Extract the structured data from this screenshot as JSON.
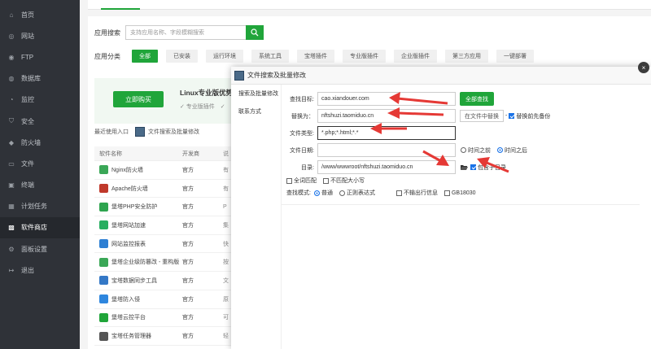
{
  "sidebar": {
    "items": [
      {
        "label": "首页",
        "icon": "home-icon"
      },
      {
        "label": "网站",
        "icon": "globe-icon"
      },
      {
        "label": "FTP",
        "icon": "ftp-icon"
      },
      {
        "label": "数据库",
        "icon": "database-icon"
      },
      {
        "label": "监控",
        "icon": "monitor-icon"
      },
      {
        "label": "安全",
        "icon": "shield-icon"
      },
      {
        "label": "防火墙",
        "icon": "firewall-icon"
      },
      {
        "label": "文件",
        "icon": "folder-icon"
      },
      {
        "label": "终端",
        "icon": "terminal-icon"
      },
      {
        "label": "计划任务",
        "icon": "calendar-icon"
      },
      {
        "label": "软件商店",
        "icon": "grid-icon",
        "active": true
      },
      {
        "label": "面板设置",
        "icon": "gear-icon"
      },
      {
        "label": "退出",
        "icon": "logout-icon"
      }
    ]
  },
  "store": {
    "search_label": "应用搜索",
    "search_placeholder": "支持应用名称、字段模糊搜索",
    "category_label": "应用分类",
    "categories": [
      "全部",
      "已安装",
      "运行环境",
      "系统工具",
      "宝塔插件",
      "专业版插件",
      "企业版插件",
      "第三方应用",
      "一键部署"
    ],
    "promo_button": "立即购买",
    "promo_title": "Linux专业版优势",
    "promo_feature": "✓ 专业版插件　✓",
    "recent_label": "最近使用入口",
    "recent_app": "文件搜索及批量修改",
    "columns": [
      "软件名称",
      "开发商",
      "说"
    ],
    "rows": [
      {
        "name": "Nginx防火墙",
        "dev": "官方",
        "extra": "有",
        "color": "#3aa757"
      },
      {
        "name": "Apache防火墙",
        "dev": "官方",
        "extra": "有",
        "color": "#c0392b"
      },
      {
        "name": "堡塔PHP安全防护",
        "dev": "官方",
        "extra": "P",
        "color": "#2ea44f"
      },
      {
        "name": "堡塔网站加速",
        "dev": "官方",
        "extra": "集",
        "color": "#27ae60"
      },
      {
        "name": "网站监控报表",
        "dev": "官方",
        "extra": "快",
        "color": "#2d7fd3"
      },
      {
        "name": "堡塔企业级防篡改 - 重构版",
        "dev": "官方",
        "extra": "按",
        "color": "#3aa757"
      },
      {
        "name": "宝塔数据同步工具",
        "dev": "官方",
        "extra": "文",
        "color": "#3478c6"
      },
      {
        "name": "堡塔防入侵",
        "dev": "官方",
        "extra": "原",
        "color": "#2e86de"
      },
      {
        "name": "堡塔云控平台",
        "dev": "官方",
        "extra": "可",
        "color": "#20a53a"
      },
      {
        "name": "宝塔任务管理器",
        "dev": "官方",
        "extra": "轻",
        "color": "#555"
      }
    ]
  },
  "dialog": {
    "title": "文件搜索及批量修改",
    "close": "×",
    "side_items": [
      "搜索及批量修改",
      "联系方式"
    ],
    "search_target_label": "查找目标:",
    "search_target_value": "cao.xiandouer.com",
    "search_all_button": "全部查找",
    "replace_label": "替换为：",
    "replace_value": "nftshuzi.taomiduo.cn",
    "replace_in_files_button": "在文件中替换",
    "backup_label": "替换前先备份",
    "file_type_label": "文件类型:",
    "file_type_value": "*.php;*.html;*.*",
    "file_date_label": "文件日期:",
    "date_before_label": "时间之前",
    "date_after_label": "时间之后",
    "directory_label": "目录:",
    "directory_value": "/www/wwwroot/nftshuzi.taomiduo.cn",
    "include_subdir_label": "包含子目录",
    "whole_word_label": "全词匹配",
    "case_insensitive_label": "不匹配大小写",
    "search_mode_label": "查找模式:",
    "mode_normal": "普通",
    "mode_regex": "正则表达式",
    "no_output_label": "不输出行信息",
    "gb_label": "GB18030"
  },
  "colors": {
    "accent": "#20a53a",
    "sidebar_bg": "#2f3238",
    "arrow": "#e53935"
  }
}
